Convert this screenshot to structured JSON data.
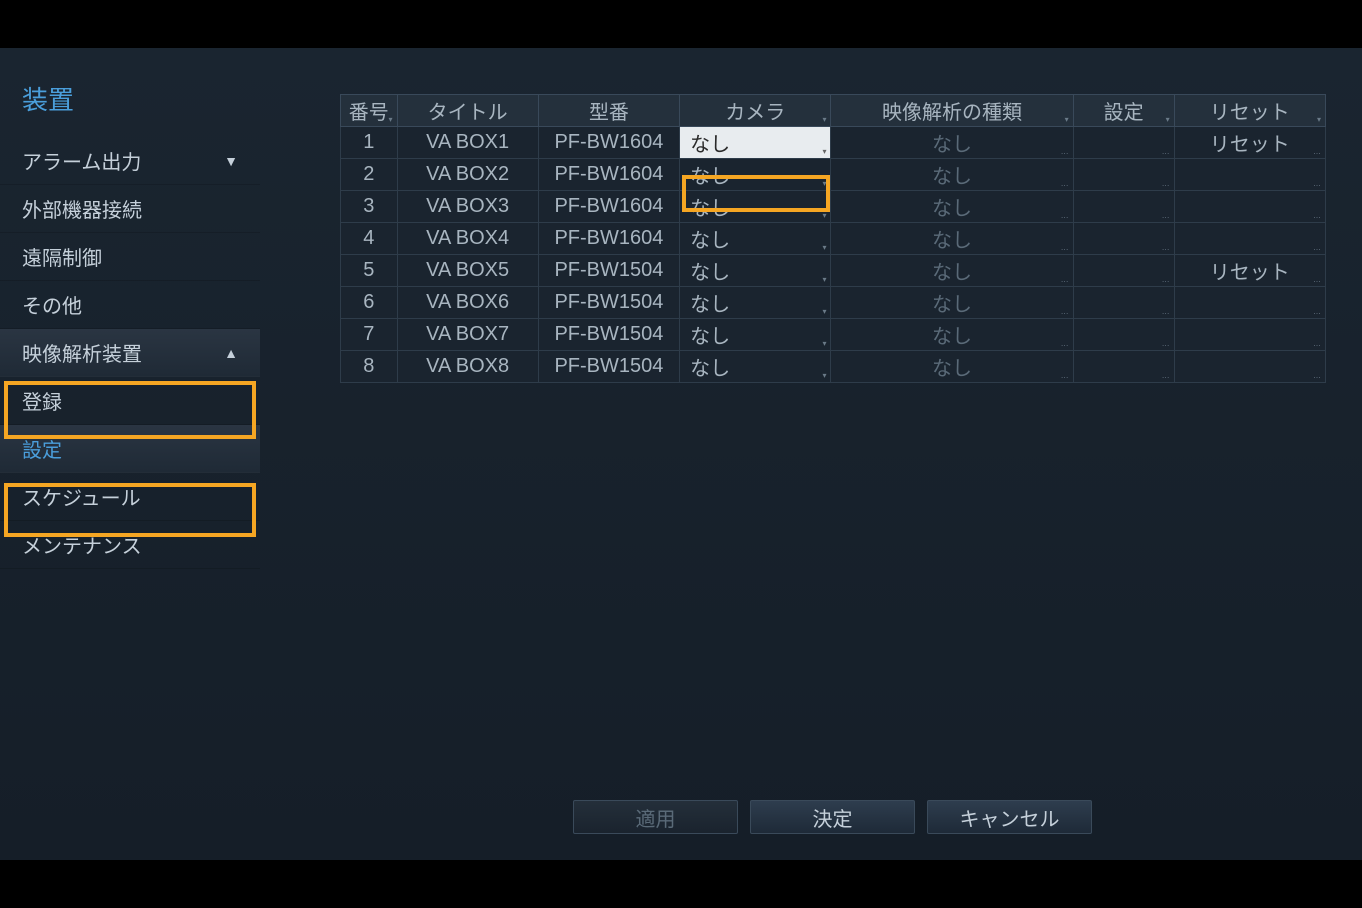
{
  "sidebar": {
    "title": "装置",
    "items": [
      {
        "label": "アラーム出力",
        "chevron": "▼"
      },
      {
        "label": "外部機器接続"
      },
      {
        "label": "遠隔制御"
      },
      {
        "label": "その他"
      },
      {
        "label": "映像解析装置",
        "chevron": "▲"
      },
      {
        "label": "登録"
      },
      {
        "label": "設定"
      },
      {
        "label": "スケジュール"
      },
      {
        "label": "メンテナンス"
      }
    ]
  },
  "table": {
    "headers": {
      "num": "番号",
      "title": "タイトル",
      "model": "型番",
      "camera": "カメラ",
      "type": "映像解析の種類",
      "settings": "設定",
      "reset": "リセット"
    },
    "rows": [
      {
        "num": "1",
        "title": "VA BOX1",
        "model": "PF-BW1604",
        "camera": "なし",
        "type": "なし",
        "settings": "",
        "reset": "リセット"
      },
      {
        "num": "2",
        "title": "VA BOX2",
        "model": "PF-BW1604",
        "camera": "なし",
        "type": "なし",
        "settings": "",
        "reset": ""
      },
      {
        "num": "3",
        "title": "VA BOX3",
        "model": "PF-BW1604",
        "camera": "なし",
        "type": "なし",
        "settings": "",
        "reset": ""
      },
      {
        "num": "4",
        "title": "VA BOX4",
        "model": "PF-BW1604",
        "camera": "なし",
        "type": "なし",
        "settings": "",
        "reset": ""
      },
      {
        "num": "5",
        "title": "VA BOX5",
        "model": "PF-BW1504",
        "camera": "なし",
        "type": "なし",
        "settings": "",
        "reset": "リセット"
      },
      {
        "num": "6",
        "title": "VA BOX6",
        "model": "PF-BW1504",
        "camera": "なし",
        "type": "なし",
        "settings": "",
        "reset": ""
      },
      {
        "num": "7",
        "title": "VA BOX7",
        "model": "PF-BW1504",
        "camera": "なし",
        "type": "なし",
        "settings": "",
        "reset": ""
      },
      {
        "num": "8",
        "title": "VA BOX8",
        "model": "PF-BW1504",
        "camera": "なし",
        "type": "なし",
        "settings": "",
        "reset": ""
      }
    ]
  },
  "footer": {
    "apply": "適用",
    "ok": "決定",
    "cancel": "キャンセル"
  }
}
